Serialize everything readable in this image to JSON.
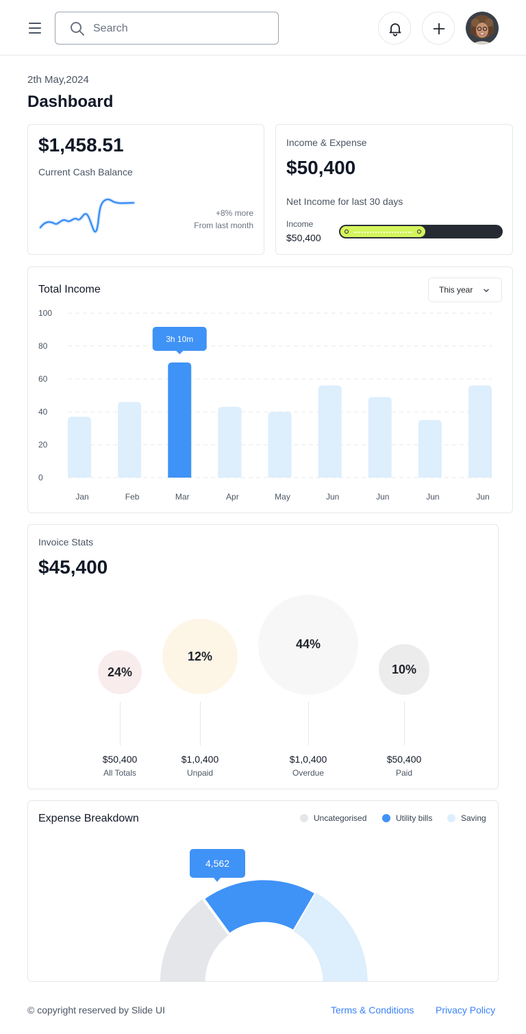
{
  "header": {
    "search_placeholder": "Search",
    "icons": {
      "menu": "menu-icon",
      "search": "search-icon",
      "bell": "bell-icon",
      "add": "plus-icon"
    }
  },
  "page": {
    "date": "2th May,2024",
    "title": "Dashboard"
  },
  "cash_card": {
    "value": "$1,458.51",
    "label": "Current Cash Balance",
    "delta": "+8% more",
    "delta_sub": "From last month",
    "line_color": "#3b8ff5"
  },
  "income_expense": {
    "title": "Income & Expense",
    "value": "$50,400",
    "subtitle": "Net Income for last 30 days",
    "income_label": "Income",
    "income_value": "$50,400",
    "progress_fraction": 0.53,
    "fill_color": "#d4f45d"
  },
  "total_income": {
    "title": "Total Income",
    "period_select": "This year",
    "tooltip": "3h 10m",
    "colors": {
      "bar": "#ddeefc",
      "highlight": "#3f92f6"
    }
  },
  "chart_data": {
    "type": "bar",
    "categories": [
      "Jan",
      "Feb",
      "Mar",
      "Apr",
      "May",
      "Jun",
      "Jun",
      "Jun",
      "Jun"
    ],
    "values": [
      37,
      46,
      70,
      43,
      40,
      56,
      49,
      35,
      56
    ],
    "yticks": [
      0,
      20,
      40,
      60,
      80,
      100
    ],
    "ylim": [
      0,
      100
    ],
    "highlight_index": 2,
    "grid": true
  },
  "invoice_stats": {
    "title": "Invoice Stats",
    "value": "$45,400",
    "items": [
      {
        "percent": "24%",
        "amount": "$50,400",
        "label": "All Totals",
        "color": "#f9ecec"
      },
      {
        "percent": "12%",
        "amount": "$1,0,400",
        "label": "Unpaid",
        "color": "#fdf6e7"
      },
      {
        "percent": "44%",
        "amount": "$1,0,400",
        "label": "Overdue",
        "color": "#f7f7f7"
      },
      {
        "percent": "10%",
        "amount": "$50,400",
        "label": "Paid",
        "color": "#ececec"
      }
    ]
  },
  "expense_breakdown": {
    "title": "Expense Breakdown",
    "tooltip": "4,562",
    "legend": [
      {
        "label": "Uncategorised",
        "color": "#e4e6ea"
      },
      {
        "label": "Utility bills",
        "color": "#3f92f6"
      },
      {
        "label": "Saving",
        "color": "#ddeefc"
      }
    ]
  },
  "footer": {
    "copyright": "© copyright reserved by Slide UI",
    "terms": "Terms & Conditions",
    "privacy": "Privacy Policy"
  }
}
